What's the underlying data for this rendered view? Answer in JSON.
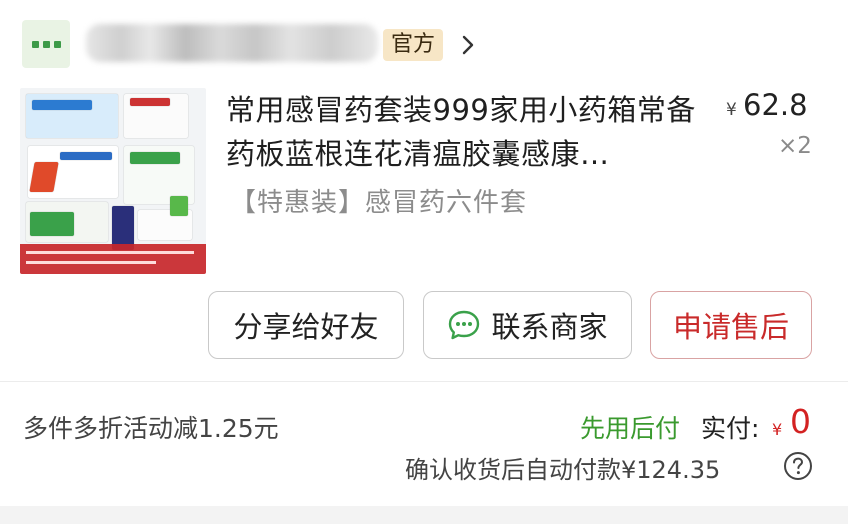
{
  "store": {
    "badge": "官方"
  },
  "product": {
    "title": "常用感冒药套装999家用小药箱常备药板蓝根连花清瘟胶囊感康…",
    "price_currency": "¥",
    "price": "62.8",
    "quantity": "×2",
    "spec": "【特惠装】感冒药六件套"
  },
  "actions": {
    "share": "分享给好友",
    "contact": "联系商家",
    "after_sale": "申请售后"
  },
  "payment": {
    "discount": "多件多折活动减1.25元",
    "pay_later": "先用后付",
    "paid_label": "实付:",
    "paid_currency": "¥",
    "paid_amount": "0",
    "auto_pay_note": "确认收货后自动付款¥124.35"
  },
  "colors": {
    "pay_later": "#3a9a2e",
    "price_red": "#d32222",
    "badge_bg": "#f7e6c6"
  },
  "icons": [
    "chevron-right-icon",
    "chat-bubble-icon",
    "help-circle-icon"
  ]
}
